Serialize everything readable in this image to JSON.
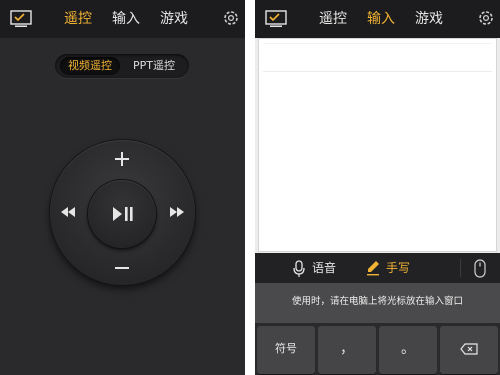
{
  "left": {
    "tabs": [
      {
        "label": "遥控",
        "active": true
      },
      {
        "label": "输入",
        "active": false
      },
      {
        "label": "游戏",
        "active": false
      }
    ],
    "segments": [
      {
        "label": "视频遥控",
        "active": true
      },
      {
        "label": "PPT遥控",
        "active": false
      }
    ],
    "remote": {
      "plus": "+",
      "minus": "−"
    }
  },
  "right": {
    "tabs": [
      {
        "label": "遥控",
        "active": false
      },
      {
        "label": "输入",
        "active": true
      },
      {
        "label": "游戏",
        "active": false
      }
    ],
    "modes": {
      "voice_label": "语音",
      "handwriting_label": "手写"
    },
    "hint": "使用时，请在电脑上将光标放在输入窗口",
    "keys": [
      "符号",
      "，",
      "。"
    ]
  },
  "colors": {
    "accent": "#f2b233",
    "topbar": "#1c1c1e",
    "panel_dark": "#2a2a2c",
    "hint_bg": "#4a4a4c"
  },
  "icons": {
    "screen": "screen-check-icon",
    "settings": "gear-icon",
    "volume_up": "plus-icon",
    "volume_down": "minus-icon",
    "rewind": "rewind-icon",
    "fast_forward": "fast-forward-icon",
    "play_pause": "play-pause-icon",
    "voice": "microphone-icon",
    "handwriting": "pencil-icon",
    "mouse": "mouse-icon",
    "backspace": "backspace-icon"
  }
}
